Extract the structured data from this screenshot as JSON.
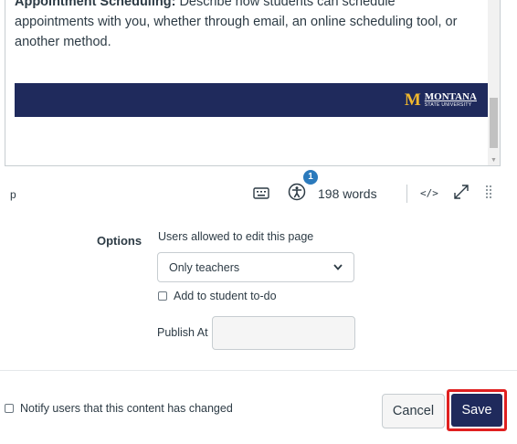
{
  "editor": {
    "heading_partial": "Appointment Scheduling:",
    "text_line1_partial": "Describe how students can schedule",
    "text_line2": "appointments with you, whether through email, an online scheduling tool, or",
    "text_line3": "another method.",
    "banner": {
      "logo_mark": "M",
      "logo_name": "MONTANA",
      "logo_sub": "STATE UNIVERSITY",
      "color": "#1f2a5c"
    }
  },
  "statusbar": {
    "path": "p",
    "a11y_badge": "1",
    "word_count": "198 words",
    "code_label": "</>"
  },
  "options": {
    "label": "Options",
    "edit_users_label": "Users allowed to edit this page",
    "edit_users_selected": "Only teachers",
    "todo_label": "Add to student to-do",
    "publish_label": "Publish At",
    "publish_value": ""
  },
  "footer": {
    "notify_label": "Notify users that this content has changed",
    "cancel_label": "Cancel",
    "save_label": "Save"
  },
  "colors": {
    "primary": "#1f2a5c",
    "highlight": "#e02020",
    "badge": "#2b7abc"
  }
}
